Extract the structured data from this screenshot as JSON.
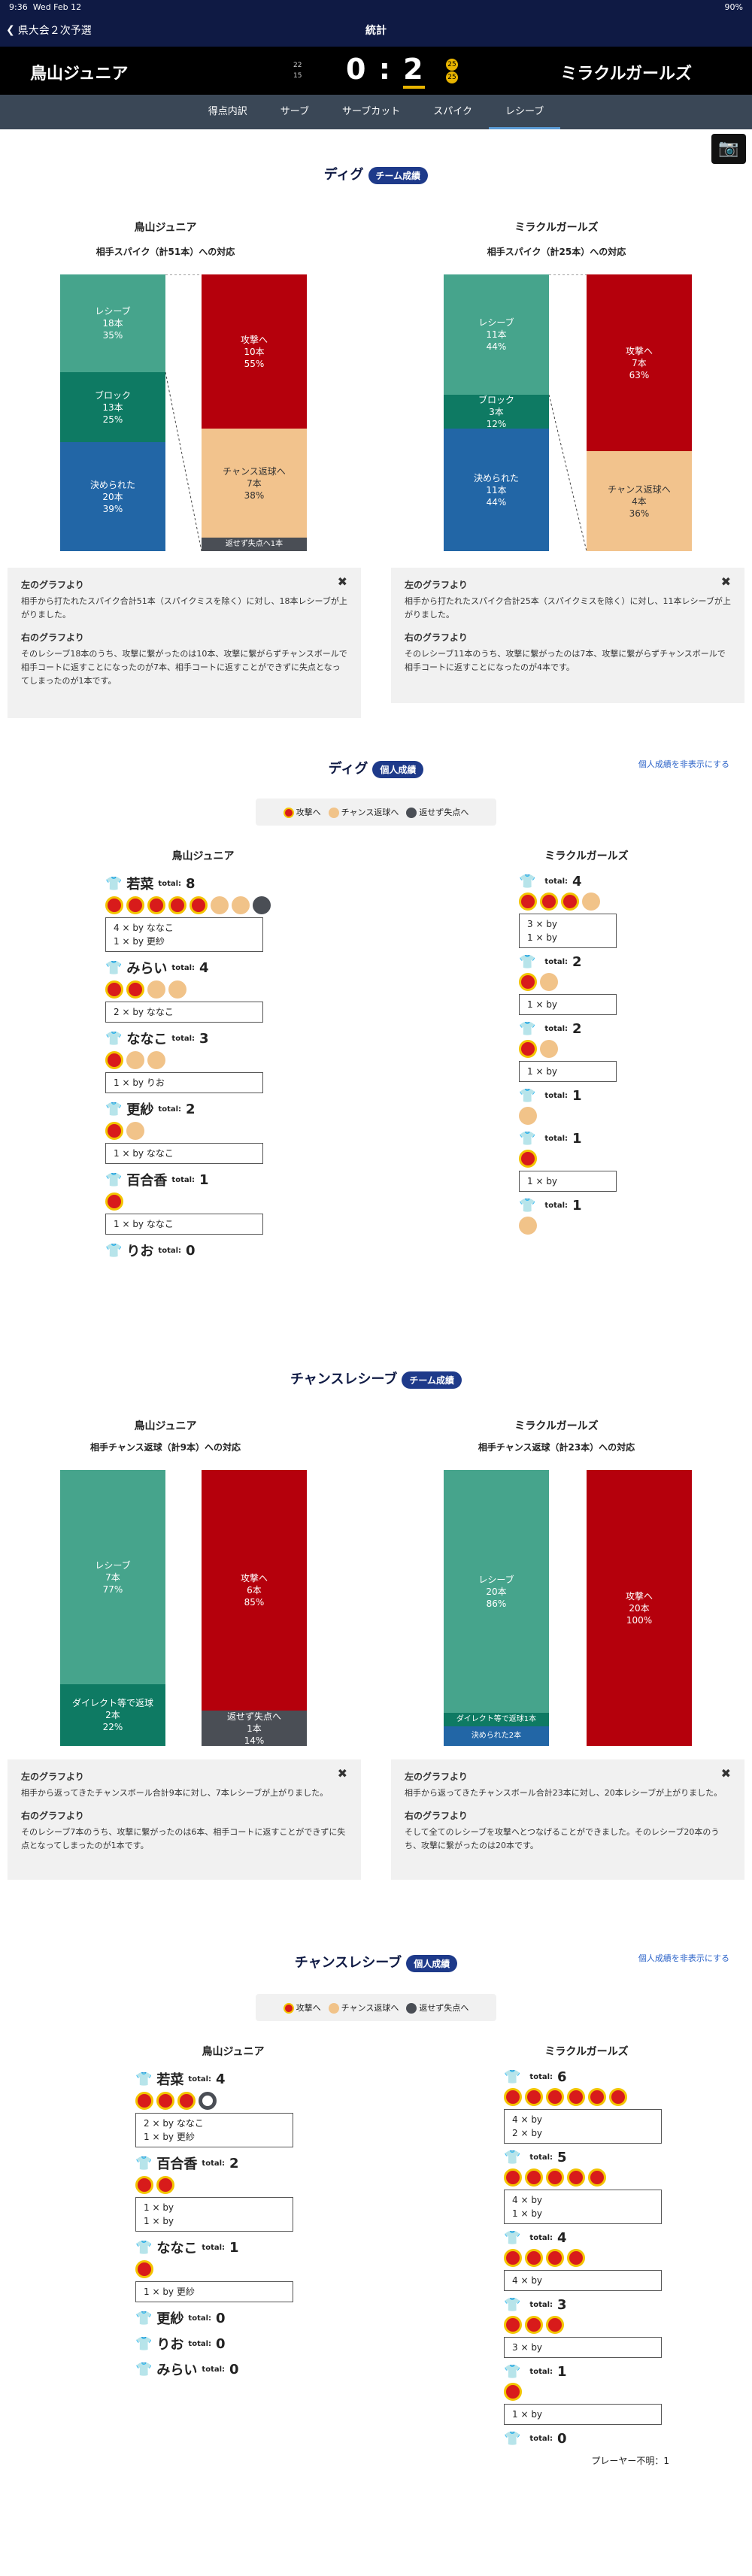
{
  "status": {
    "time": "9:36",
    "date": "Wed Feb 12",
    "battery": "90%"
  },
  "nav": {
    "back": "県大会２次予選",
    "title": "統計"
  },
  "score": {
    "left_team": "鳥山ジュニア",
    "right_team": "ミラクルガールズ",
    "left": "0",
    "colon": ":",
    "right": "2",
    "left_sets": [
      "22",
      "15"
    ],
    "right_sets": [
      "25",
      "25"
    ]
  },
  "tabs": [
    "得点内訳",
    "サーブ",
    "サーブカット",
    "スパイク",
    "レシーブ"
  ],
  "dig_team": {
    "title": "ディグ",
    "badge": "チーム成績",
    "left": {
      "name": "鳥山ジュニア",
      "sub": "相手スパイク（計51本）への対応",
      "recv": [
        "レシーブ",
        "18本",
        "35%"
      ],
      "block": [
        "ブロック",
        "13本",
        "25%"
      ],
      "fail": [
        "決められた",
        "20本",
        "39%"
      ],
      "atk": [
        "攻撃へ",
        "10本",
        "55%"
      ],
      "ch": [
        "チャンス返球へ",
        "7本",
        "38%"
      ],
      "ret": "返せず失点へ1本"
    },
    "right": {
      "name": "ミラクルガールズ",
      "sub": "相手スパイク（計25本）への対応",
      "recv": [
        "レシーブ",
        "11本",
        "44%"
      ],
      "block": [
        "ブロック",
        "3本",
        "12%"
      ],
      "fail": [
        "決められた",
        "11本",
        "44%"
      ],
      "atk": [
        "攻撃へ",
        "7本",
        "63%"
      ],
      "ch": [
        "チャンス返球へ",
        "4本",
        "36%"
      ]
    },
    "note_left": {
      "h1": "左のグラフより",
      "t1": "相手から打たれたスパイク合計51本（スパイクミスを除く）に対し、18本レシーブが上がりました。",
      "h2": "右のグラフより",
      "t2": "そのレシーブ18本のうち、攻撃に繋がったのは10本、攻撃に繋がらずチャンスボールで相手コートに返すことになったのが7本、相手コートに返すことができずに失点となってしまったのが1本です。"
    },
    "note_right": {
      "h1": "左のグラフより",
      "t1": "相手から打たれたスパイク合計25本（スパイクミスを除く）に対し、11本レシーブが上がりました。",
      "h2": "右のグラフより",
      "t2": "そのレシーブ11本のうち、攻撃に繋がったのは7本、攻撃に繋がらずチャンスボールで相手コートに返すことになったのが4本です。"
    }
  },
  "dig_ind": {
    "title": "ディグ",
    "badge": "個人成績",
    "hide": "個人成績を非表示にする",
    "legend": [
      "攻撃へ",
      "チャンス返球へ",
      "返せず失点へ"
    ],
    "left_name": "鳥山ジュニア",
    "right_name": "ミラクルガールズ",
    "left": [
      {
        "name": "若菜",
        "total": "8",
        "dots": [
          "a",
          "a",
          "a",
          "a",
          "a",
          "c",
          "c",
          "r"
        ],
        "lines": [
          "4 × by ななこ",
          "1 × by 更紗"
        ]
      },
      {
        "name": "みらい",
        "total": "4",
        "dots": [
          "a",
          "a",
          "c",
          "c"
        ],
        "lines": [
          "2 × by ななこ"
        ]
      },
      {
        "name": "ななこ",
        "total": "3",
        "dots": [
          "a",
          "c",
          "c"
        ],
        "lines": [
          "1 × by りお"
        ]
      },
      {
        "name": "更紗",
        "total": "2",
        "dots": [
          "a",
          "c"
        ],
        "lines": [
          "1 × by ななこ"
        ]
      },
      {
        "name": "百合香",
        "total": "1",
        "dots": [
          "a"
        ],
        "lines": [
          "1 × by ななこ"
        ]
      },
      {
        "name": "りお",
        "total": "0",
        "dots": [],
        "lines": []
      }
    ],
    "right": [
      {
        "name": "",
        "total": "4",
        "dots": [
          "a",
          "a",
          "a",
          "c"
        ],
        "lines": [
          "3 × by",
          "1 × by"
        ]
      },
      {
        "name": "",
        "total": "2",
        "dots": [
          "a",
          "c"
        ],
        "lines": [
          "1 × by"
        ]
      },
      {
        "name": "",
        "total": "2",
        "dots": [
          "a",
          "c"
        ],
        "lines": [
          "1 × by"
        ]
      },
      {
        "name": "",
        "total": "1",
        "dots": [
          "c"
        ],
        "lines": []
      },
      {
        "name": "",
        "total": "1",
        "dots": [
          "a"
        ],
        "lines": [
          "1 × by"
        ]
      },
      {
        "name": "",
        "total": "1",
        "dots": [
          "c"
        ],
        "lines": []
      }
    ]
  },
  "ch_team": {
    "title": "チャンスレシーブ",
    "badge": "チーム成績",
    "left": {
      "name": "鳥山ジュニア",
      "sub": "相手チャンス返球（計9本）への対応",
      "recv": [
        "レシーブ",
        "7本",
        "77%"
      ],
      "direct": [
        "ダイレクト等で返球",
        "2本",
        "22%"
      ],
      "atk": [
        "攻撃へ",
        "6本",
        "85%"
      ],
      "ret": [
        "返せず失点へ",
        "1本",
        "14%"
      ]
    },
    "right": {
      "name": "ミラクルガールズ",
      "sub": "相手チャンス返球（計23本）への対応",
      "recv": [
        "レシーブ",
        "20本",
        "86%"
      ],
      "direct": "ダイレクト等で返球1本",
      "fail": "決められた2本",
      "atk": [
        "攻撃へ",
        "20本",
        "100%"
      ]
    },
    "note_left": {
      "h1": "左のグラフより",
      "t1": "相手から返ってきたチャンスボール合計9本に対し、7本レシーブが上がりました。",
      "h2": "右のグラフより",
      "t2": "そのレシーブ7本のうち、攻撃に繋がったのは6本、相手コートに返すことができずに失点となってしまったのが1本です。"
    },
    "note_right": {
      "h1": "左のグラフより",
      "t1": "相手から返ってきたチャンスボール合計23本に対し、20本レシーブが上がりました。",
      "h2": "右のグラフより",
      "t2": "そして全てのレシーブを攻撃へとつなげることができました。そのレシーブ20本のうち、攻撃に繋がったのは20本です。"
    }
  },
  "ch_ind": {
    "title": "チャンスレシーブ",
    "badge": "個人成績",
    "hide": "個人成績を非表示にする",
    "legend": [
      "攻撃へ",
      "チャンス返球へ",
      "返せず失点へ"
    ],
    "left_name": "鳥山ジュニア",
    "right_name": "ミラクルガールズ",
    "left": [
      {
        "name": "若菜",
        "total": "4",
        "dots": [
          "a",
          "a",
          "a",
          "R"
        ],
        "lines": [
          "2 × by ななこ",
          "1 × by 更紗"
        ]
      },
      {
        "name": "百合香",
        "total": "2",
        "dots": [
          "a",
          "a"
        ],
        "lines": [
          "1 × by",
          "1 × by"
        ]
      },
      {
        "name": "ななこ",
        "total": "1",
        "dots": [
          "a"
        ],
        "lines": [
          "1 × by 更紗"
        ]
      },
      {
        "name": "更紗",
        "total": "0",
        "dots": [],
        "lines": []
      },
      {
        "name": "りお",
        "total": "0",
        "dots": [],
        "lines": []
      },
      {
        "name": "みらい",
        "total": "0",
        "dots": [],
        "lines": []
      }
    ],
    "right": [
      {
        "name": "",
        "total": "6",
        "dots": [
          "a",
          "a",
          "a",
          "a",
          "a",
          "a"
        ],
        "lines": [
          "4 × by",
          "2 × by"
        ]
      },
      {
        "name": "",
        "total": "5",
        "dots": [
          "a",
          "a",
          "a",
          "a",
          "a"
        ],
        "lines": [
          "4 × by",
          "1 × by"
        ]
      },
      {
        "name": "",
        "total": "4",
        "dots": [
          "a",
          "a",
          "a",
          "a"
        ],
        "lines": [
          "4 × by"
        ]
      },
      {
        "name": "",
        "total": "3",
        "dots": [
          "a",
          "a",
          "a"
        ],
        "lines": [
          "3 × by"
        ]
      },
      {
        "name": "",
        "total": "1",
        "dots": [
          "a"
        ],
        "lines": [
          "1 × by"
        ]
      },
      {
        "name": "",
        "total": "0",
        "dots": [],
        "lines": []
      }
    ],
    "unknown": "プレーヤー不明：1"
  }
}
